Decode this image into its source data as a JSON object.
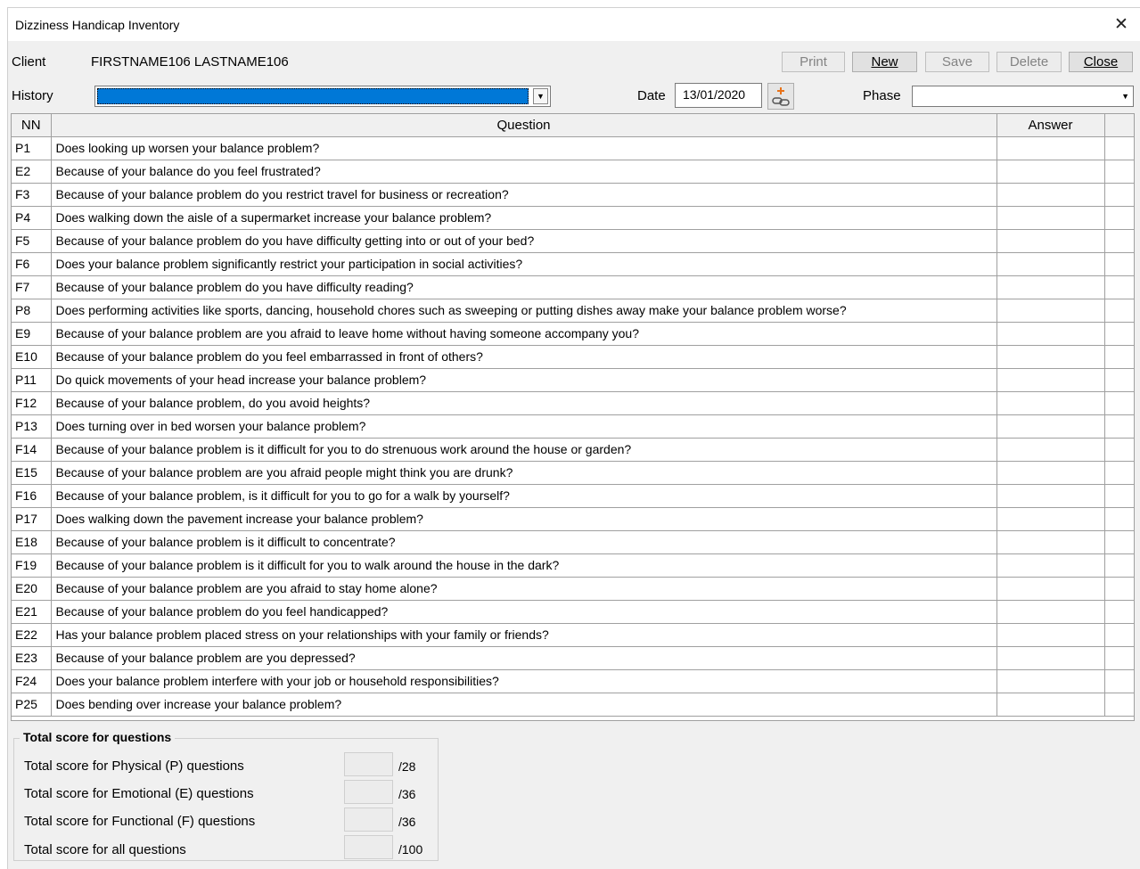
{
  "window": {
    "title": "Dizziness Handicap Inventory",
    "close_glyph": "✕"
  },
  "client": {
    "label": "Client",
    "name": "FIRSTNAME106 LASTNAME106"
  },
  "toolbar": {
    "print": "Print",
    "new": "New",
    "save": "Save",
    "delete": "Delete",
    "close": "Close"
  },
  "history": {
    "label": "History",
    "value": ""
  },
  "date": {
    "label": "Date",
    "value": "13/01/2020"
  },
  "phase": {
    "label": "Phase",
    "value": ""
  },
  "grid": {
    "headers": [
      "NN",
      "Question",
      "Answer",
      ""
    ],
    "rows": [
      {
        "nn": "P1",
        "q": "Does looking up worsen your balance problem?",
        "a": ""
      },
      {
        "nn": "E2",
        "q": "Because of your balance do you feel frustrated?",
        "a": ""
      },
      {
        "nn": "F3",
        "q": "Because of your balance problem do you restrict travel for business or recreation?",
        "a": ""
      },
      {
        "nn": "P4",
        "q": "Does walking down the aisle of a supermarket increase your balance problem?",
        "a": ""
      },
      {
        "nn": "F5",
        "q": "Because of your balance problem do you have difficulty getting into or out of your bed?",
        "a": ""
      },
      {
        "nn": "F6",
        "q": "Does your balance problem significantly restrict your participation in social activities?",
        "a": ""
      },
      {
        "nn": "F7",
        "q": "Because of your balance problem do you have difficulty reading?",
        "a": ""
      },
      {
        "nn": "P8",
        "q": "Does performing activities like sports, dancing, household chores such as sweeping or putting dishes away make your balance problem worse?",
        "a": ""
      },
      {
        "nn": "E9",
        "q": "Because of your balance problem are you afraid to leave home without having someone accompany you?",
        "a": ""
      },
      {
        "nn": "E10",
        "q": "Because of your balance problem do you feel embarrassed in front of others?",
        "a": ""
      },
      {
        "nn": "P11",
        "q": "Do quick movements of your head increase your balance problem?",
        "a": ""
      },
      {
        "nn": "F12",
        "q": "Because of your balance problem, do you avoid heights?",
        "a": ""
      },
      {
        "nn": "P13",
        "q": "Does turning over in bed worsen your balance problem?",
        "a": ""
      },
      {
        "nn": "F14",
        "q": "Because of your balance problem is it difficult for you to do strenuous work around the house or garden?",
        "a": ""
      },
      {
        "nn": "E15",
        "q": "Because of your balance problem are you afraid people might think you are drunk?",
        "a": ""
      },
      {
        "nn": "F16",
        "q": "Because of your balance problem, is it difficult for you to go for a walk by yourself?",
        "a": ""
      },
      {
        "nn": "P17",
        "q": "Does walking down the pavement increase your balance problem?",
        "a": ""
      },
      {
        "nn": "E18",
        "q": "Because of your balance problem is it difficult to concentrate?",
        "a": ""
      },
      {
        "nn": "F19",
        "q": "Because of your balance problem is it difficult for you to walk around the house in the dark?",
        "a": ""
      },
      {
        "nn": "E20",
        "q": "Because of your balance problem are you afraid to stay home alone?",
        "a": ""
      },
      {
        "nn": "E21",
        "q": "Because of your balance problem do you feel handicapped?",
        "a": ""
      },
      {
        "nn": "E22",
        "q": "Has your balance problem placed stress on your relationships with your family or friends?",
        "a": ""
      },
      {
        "nn": "E23",
        "q": "Because of your balance problem are you depressed?",
        "a": ""
      },
      {
        "nn": "F24",
        "q": "Does your balance problem interfere with your job or household responsibilities?",
        "a": ""
      },
      {
        "nn": "P25",
        "q": "Does bending over increase your balance problem?",
        "a": ""
      }
    ]
  },
  "totals": {
    "title": "Total score for questions",
    "physical": {
      "label": "Total score for Physical (P) questions",
      "value": "",
      "max": "/28"
    },
    "emotional": {
      "label": "Total score for Emotional (E) questions",
      "value": "",
      "max": "/36"
    },
    "functional": {
      "label": "Total score for Functional (F) questions",
      "value": "",
      "max": "/36"
    },
    "all": {
      "label": "Total score for all questions",
      "value": "",
      "max": "/100"
    }
  },
  "colors": {
    "selection": "#0078d7",
    "window_bg": "#f0f0f0",
    "grid_line": "#a0a0a0"
  }
}
